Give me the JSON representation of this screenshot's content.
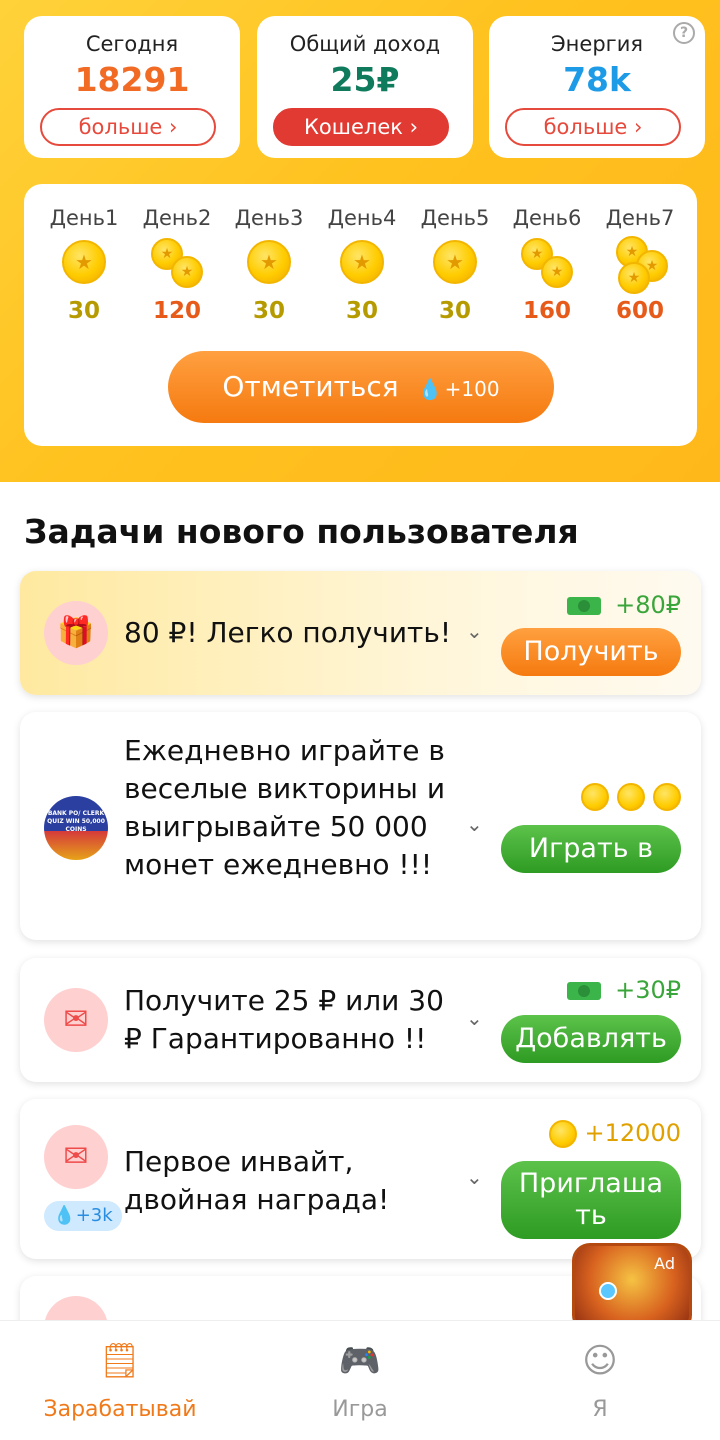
{
  "stats": {
    "today": {
      "title": "Сегодня",
      "value": "18291",
      "button": "больше ›",
      "color": "#f26b25"
    },
    "income": {
      "title": "Общий доход",
      "value": "25₽",
      "button": "Кошелек ›",
      "color": "#0f7a5c"
    },
    "energy": {
      "title": "Энергия",
      "value": "78k",
      "button": "больше ›",
      "color": "#1e9be6",
      "help": "?"
    }
  },
  "checkin": {
    "days": [
      {
        "label": "День1",
        "value": "30",
        "coins": 1
      },
      {
        "label": "День2",
        "value": "120",
        "coins": 2
      },
      {
        "label": "День3",
        "value": "30",
        "coins": 1
      },
      {
        "label": "День4",
        "value": "30",
        "coins": 1
      },
      {
        "label": "День5",
        "value": "30",
        "coins": 1
      },
      {
        "label": "День6",
        "value": "160",
        "coins": 2
      },
      {
        "label": "День7",
        "value": "600",
        "coins": 3
      }
    ],
    "button_label": "Отметиться",
    "button_bonus": "+100"
  },
  "section_title": "Задачи нового пользователя",
  "tasks": [
    {
      "text": "80 ₽! Легко получить!",
      "reward": "+80₽",
      "button": "Получить",
      "icon": "gift-icon",
      "glyph": "🎁"
    },
    {
      "text": "Ежедневно играйте в веселые викторины и выигрывайте 50 000 монет ежедневно !!!",
      "button": "Играть в",
      "icon": "quiz-logo-icon",
      "logo_text": "BANK PO/ CLERK QUIZ WIN 50,000 COINS"
    },
    {
      "text": "Получите 25 ₽ или 30 ₽ Гарантированно !!",
      "reward": "+30₽",
      "button": "Добавлять",
      "icon": "envelope-heart-icon",
      "glyph": "✉"
    },
    {
      "text": "Первое инвайт, двойная награда!",
      "reward": "+12000",
      "button": "Приглаша ть",
      "icon": "invite-envelope-icon",
      "glyph": "✉",
      "badge": "+3k"
    }
  ],
  "chest": {
    "ad_label": "Ad"
  },
  "nav": [
    {
      "label": "Зарабатывай",
      "icon": "earn-icon",
      "glyph": "🗒",
      "active": true
    },
    {
      "label": "Игра",
      "icon": "gamepad-icon",
      "glyph": "🎮",
      "active": false
    },
    {
      "label": "Я",
      "icon": "profile-icon",
      "glyph": "☺",
      "active": false
    }
  ]
}
